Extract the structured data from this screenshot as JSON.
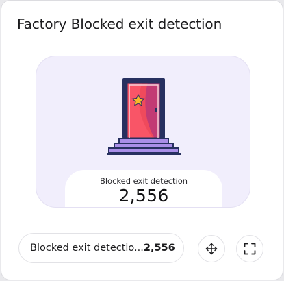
{
  "card": {
    "title": "Factory Blocked exit detection",
    "hero": {
      "icon": "door-icon",
      "stat_label": "Blocked exit detection",
      "stat_value": "2,556"
    },
    "footer": {
      "label": "Blocked exit detectio...",
      "value": "2,556",
      "buttons": [
        {
          "icon": "move-icon"
        },
        {
          "icon": "fullscreen-icon"
        }
      ]
    }
  },
  "colors": {
    "hero_background": "#f1eefc",
    "door_frame": "#273060",
    "door_panel": "#ef4a5c",
    "door_shade": "#c23a74",
    "door_star": "#f7b928",
    "steps": "#a98ee8"
  }
}
